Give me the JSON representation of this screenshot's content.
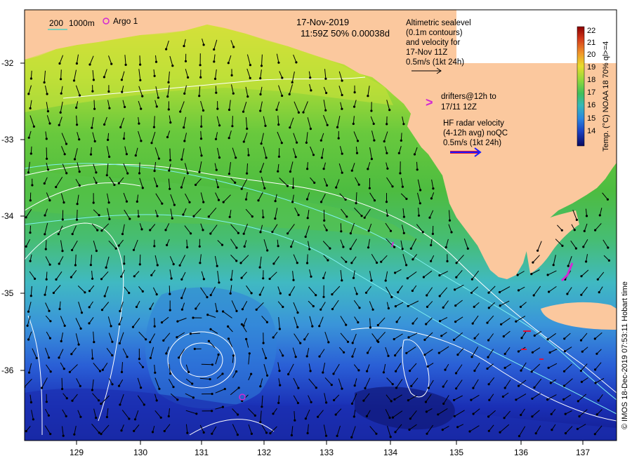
{
  "header": {
    "date": "17-Nov-2019",
    "time_line": "11:59Z  50% 0.00038d"
  },
  "isobath_legend": {
    "label_200": "200",
    "label_1000": "1000m"
  },
  "argo_legend": {
    "label": "Argo 1"
  },
  "altimetry_note": {
    "lines": [
      "Altimetric sealevel",
      "(0.1m contours)",
      "and velocity for",
      "17-Nov 11Z",
      "0.5m/s (1kt 24h)"
    ]
  },
  "drifter_note": {
    "symbol": ">",
    "lines": [
      "drifters@12h to",
      "17/11 12Z"
    ]
  },
  "hf_radar_note": {
    "lines": [
      "HF radar velocity",
      "(4-12h avg) noQC",
      "0.5m/s (1kt 24h)"
    ]
  },
  "axes": {
    "lat_ticks": [
      "-32",
      "-33",
      "-34",
      "-35",
      "-36"
    ],
    "lon_ticks": [
      "129",
      "130",
      "131",
      "132",
      "133",
      "134",
      "135",
      "136",
      "137"
    ]
  },
  "colorbar": {
    "title": "Temp. (°C) NOAA 18 70% ql>=4",
    "ticks": [
      "22",
      "21",
      "20",
      "19",
      "18",
      "17",
      "16",
      "15",
      "14"
    ],
    "colors": [
      "#8b0000",
      "#c0281c",
      "#e8621a",
      "#f2a12a",
      "#e6d62c",
      "#b8dd3a",
      "#6fcf3a",
      "#3cc07a",
      "#33b3c8",
      "#2a8fe0",
      "#1b5cd8",
      "#141e9e",
      "#0a0a50"
    ]
  },
  "credit": "© IMOS 18-Dec-2019 07:53:11 Hobart time",
  "colors": {
    "land": "#fbc89e",
    "argo": "#d228d2",
    "hf_radar": "#1a1aff",
    "hf_radar_outline": "#e0103a"
  }
}
